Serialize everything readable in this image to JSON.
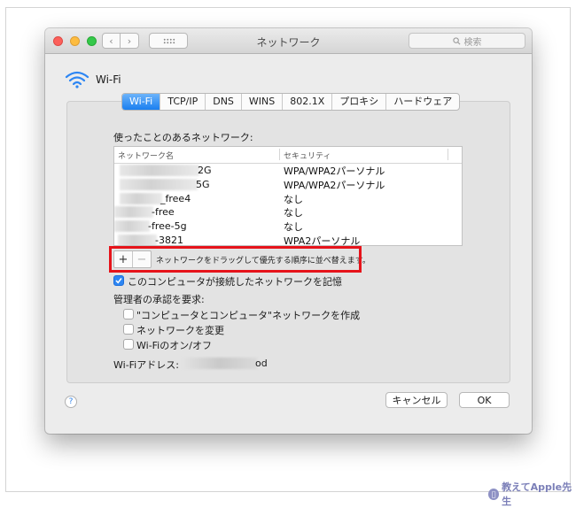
{
  "window": {
    "title": "ネットワーク"
  },
  "toolbar": {
    "back_label": "‹",
    "forward_label": "›",
    "search_placeholder": "検索"
  },
  "header": {
    "title": "Wi-Fi"
  },
  "tabs": [
    {
      "label": "Wi-Fi",
      "active": true
    },
    {
      "label": "TCP/IP",
      "active": false
    },
    {
      "label": "DNS",
      "active": false
    },
    {
      "label": "WINS",
      "active": false
    },
    {
      "label": "802.1X",
      "active": false
    },
    {
      "label": "プロキシ",
      "active": false
    },
    {
      "label": "ハードウェア",
      "active": false
    }
  ],
  "networks": {
    "heading": "使ったことのあるネットワーク:",
    "columns": {
      "name": "ネットワーク名",
      "security": "セキュリティ"
    },
    "rows": [
      {
        "name_visible": "2G",
        "security": "WPA/WPA2パーソナル"
      },
      {
        "name_visible": "5G",
        "security": "WPA/WPA2パーソナル"
      },
      {
        "name_visible": "_free4",
        "security": "なし"
      },
      {
        "name_visible": "-free",
        "security": "なし"
      },
      {
        "name_visible": "-free-5g",
        "security": "なし"
      },
      {
        "name_visible": "-3821",
        "security": "WPA2パーソナル"
      }
    ]
  },
  "list_controls": {
    "add_label": "+",
    "remove_label": "−",
    "hint": "ネットワークをドラッグして優先する順序に並べ替えます。"
  },
  "remember_option": {
    "label": "このコンピュータが接続したネットワークを記憶",
    "checked": true
  },
  "admin": {
    "heading": "管理者の承認を要求:",
    "options": [
      {
        "label": "\"コンピュータとコンピュータ\"ネットワークを作成",
        "checked": false
      },
      {
        "label": "ネットワークを変更",
        "checked": false
      },
      {
        "label": "Wi-Fiのオン/オフ",
        "checked": false
      }
    ]
  },
  "mac_address": {
    "label": "Wi-Fiアドレス:",
    "value_visible": "od"
  },
  "footer": {
    "help_label": "?",
    "cancel_label": "キャンセル",
    "ok_label": "OK"
  },
  "watermark": {
    "text": "教えてApple先生"
  },
  "colors": {
    "accent": "#1a7ff0",
    "highlight_box": "#e6131a",
    "close": "#fc605b",
    "minimize": "#fdbc40",
    "maximize": "#34c84a"
  }
}
